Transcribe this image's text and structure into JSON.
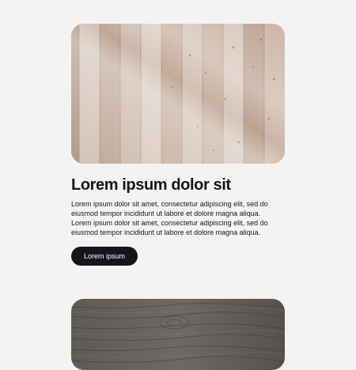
{
  "cards": [
    {
      "title": "Lorem ipsum dolor sit",
      "body": "Lorem ipsum dolor sit amet, consectetur adipiscing elit, sed do eiusmod tempor incididunt ut labore et dolore magna aliqua. Lorem ipsum dolor sit amet, consectetur adipiscing elit, sed do eiusmod tempor incididunt ut labore et dolore magna aliqua.",
      "cta_label": "Lorem ipsum",
      "image": "light-wood-planks-image"
    },
    {
      "image": "dark-weathered-wood-image"
    }
  ],
  "colors": {
    "background": "#f3f3f3",
    "text": "#14161a",
    "button_bg": "#14161a",
    "button_text": "#ffffff"
  }
}
